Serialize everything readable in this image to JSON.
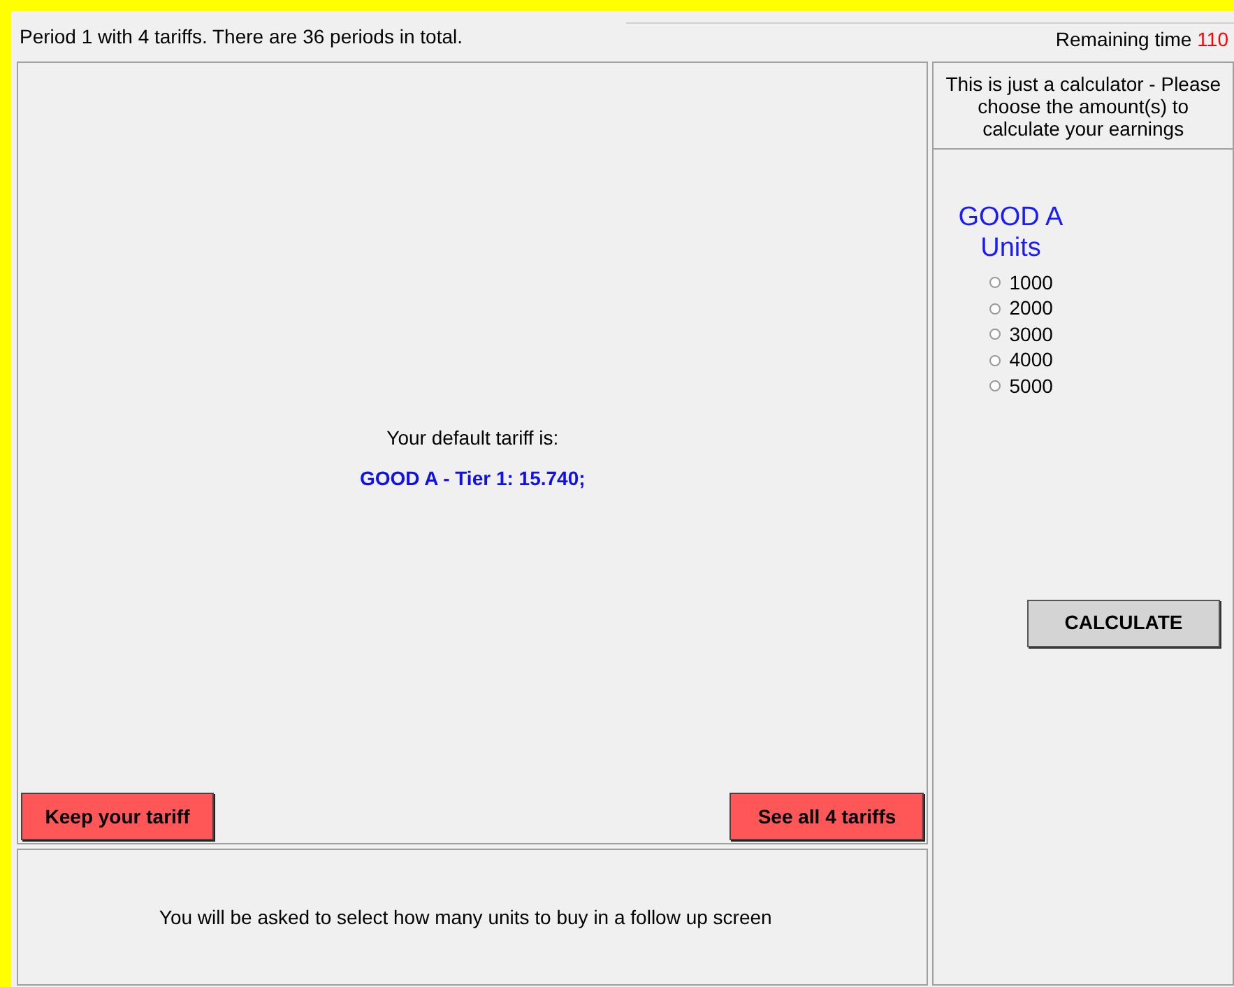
{
  "header": {
    "period_info": "Period 1 with 4 tariffs. There are 36 periods in total.",
    "remaining_label": "Remaining time",
    "remaining_value": "110"
  },
  "main": {
    "default_label": "Your default tariff is:",
    "default_tariff": "GOOD A - Tier 1: 15.740;",
    "buttons": [
      "Keep your tariff",
      "See all 4 tariffs"
    ],
    "note": "You will be asked to select how many units to buy in a follow up screen"
  },
  "calculator": {
    "intro": "This is just a calculator - Please choose the amount(s) to calculate your earnings",
    "good_title": "GOOD A",
    "units_label": "Units",
    "options": [
      {
        "label": "1000",
        "selected": false
      },
      {
        "label": "2000",
        "selected": false
      },
      {
        "label": "3000",
        "selected": false
      },
      {
        "label": "4000",
        "selected": false
      },
      {
        "label": "5000",
        "selected": false
      }
    ],
    "button": "CALCULATE"
  }
}
